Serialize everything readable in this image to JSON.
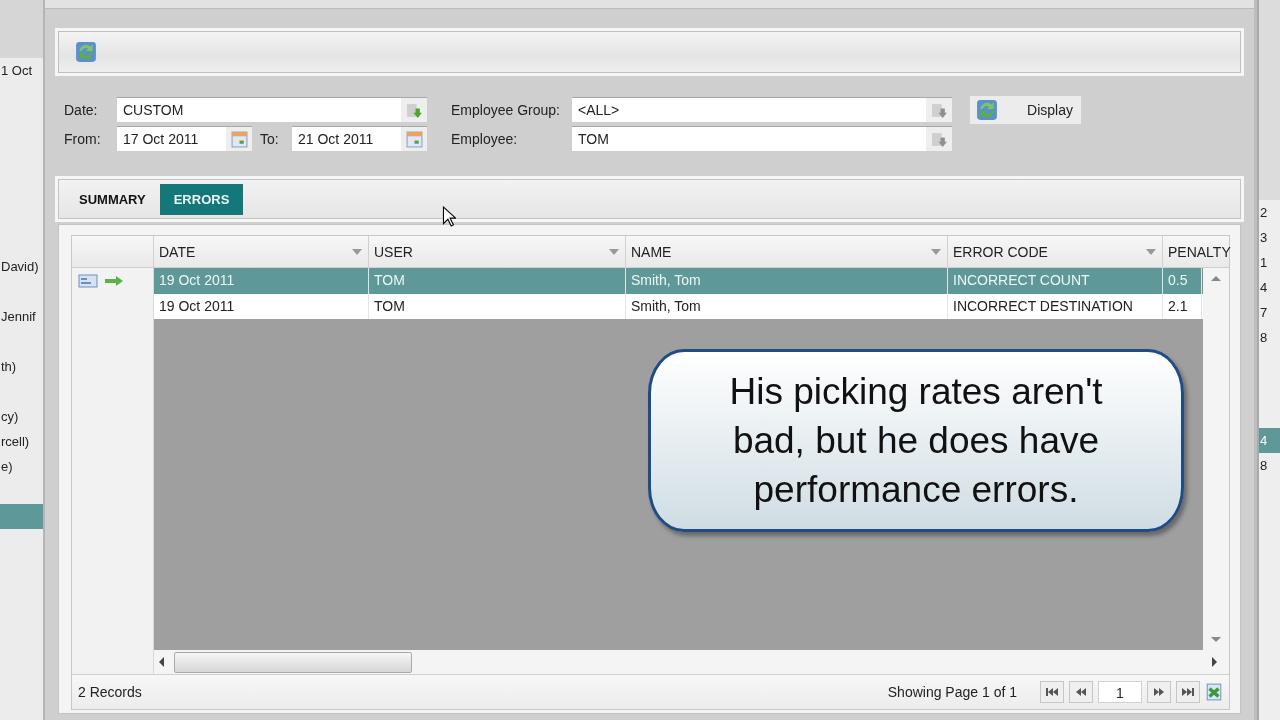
{
  "background_left": {
    "rows": [
      {
        "text": "1 Oct",
        "selected": false
      },
      {
        "text": "David)",
        "selected": false
      },
      {
        "text": "Jennif",
        "selected": false
      },
      {
        "text": "th)",
        "selected": false
      },
      {
        "text": "cy)",
        "selected": false
      },
      {
        "text": "rcell)",
        "selected": false
      },
      {
        "text": "e)",
        "selected": false
      },
      {
        "selected": true
      }
    ]
  },
  "background_right": {
    "rows": [
      {
        "text": "2",
        "selected": false
      },
      {
        "text": "3",
        "selected": false
      },
      {
        "text": "1",
        "selected": false
      },
      {
        "text": "4",
        "selected": false
      },
      {
        "text": "7",
        "selected": false
      },
      {
        "text": "8",
        "selected": false
      },
      {
        "text": "4",
        "selected": true
      },
      {
        "text": "8",
        "selected": false
      }
    ]
  },
  "filters": {
    "date": {
      "label": "Date:",
      "value": "CUSTOM"
    },
    "from": {
      "label": "From:",
      "value": "17 Oct 2011"
    },
    "to": {
      "label": "To:",
      "value": "21 Oct 2011"
    },
    "employee_group": {
      "label": "Employee Group:",
      "value": "<ALL>"
    },
    "employee": {
      "label": "Employee:",
      "value": "TOM"
    },
    "display_button": "Display"
  },
  "tabs": [
    {
      "label": "SUMMARY",
      "selected": false
    },
    {
      "label": "ERRORS",
      "selected": true
    }
  ],
  "table": {
    "columns": [
      "DATE",
      "USER",
      "NAME",
      "ERROR CODE",
      "PENALTY"
    ],
    "rows": [
      {
        "cells": [
          "19 Oct 2011",
          "TOM",
          "Smith, Tom",
          "INCORRECT COUNT",
          "0.5"
        ],
        "selected": true
      },
      {
        "cells": [
          "19 Oct 2011",
          "TOM",
          "Smith, Tom",
          "INCORRECT DESTINATION",
          "2.1"
        ],
        "selected": false
      }
    ]
  },
  "footer": {
    "records": "2 Records",
    "page_info": "Showing Page 1 of 1",
    "page": "1"
  },
  "callout": "His picking rates aren't bad, but he does have performance errors."
}
